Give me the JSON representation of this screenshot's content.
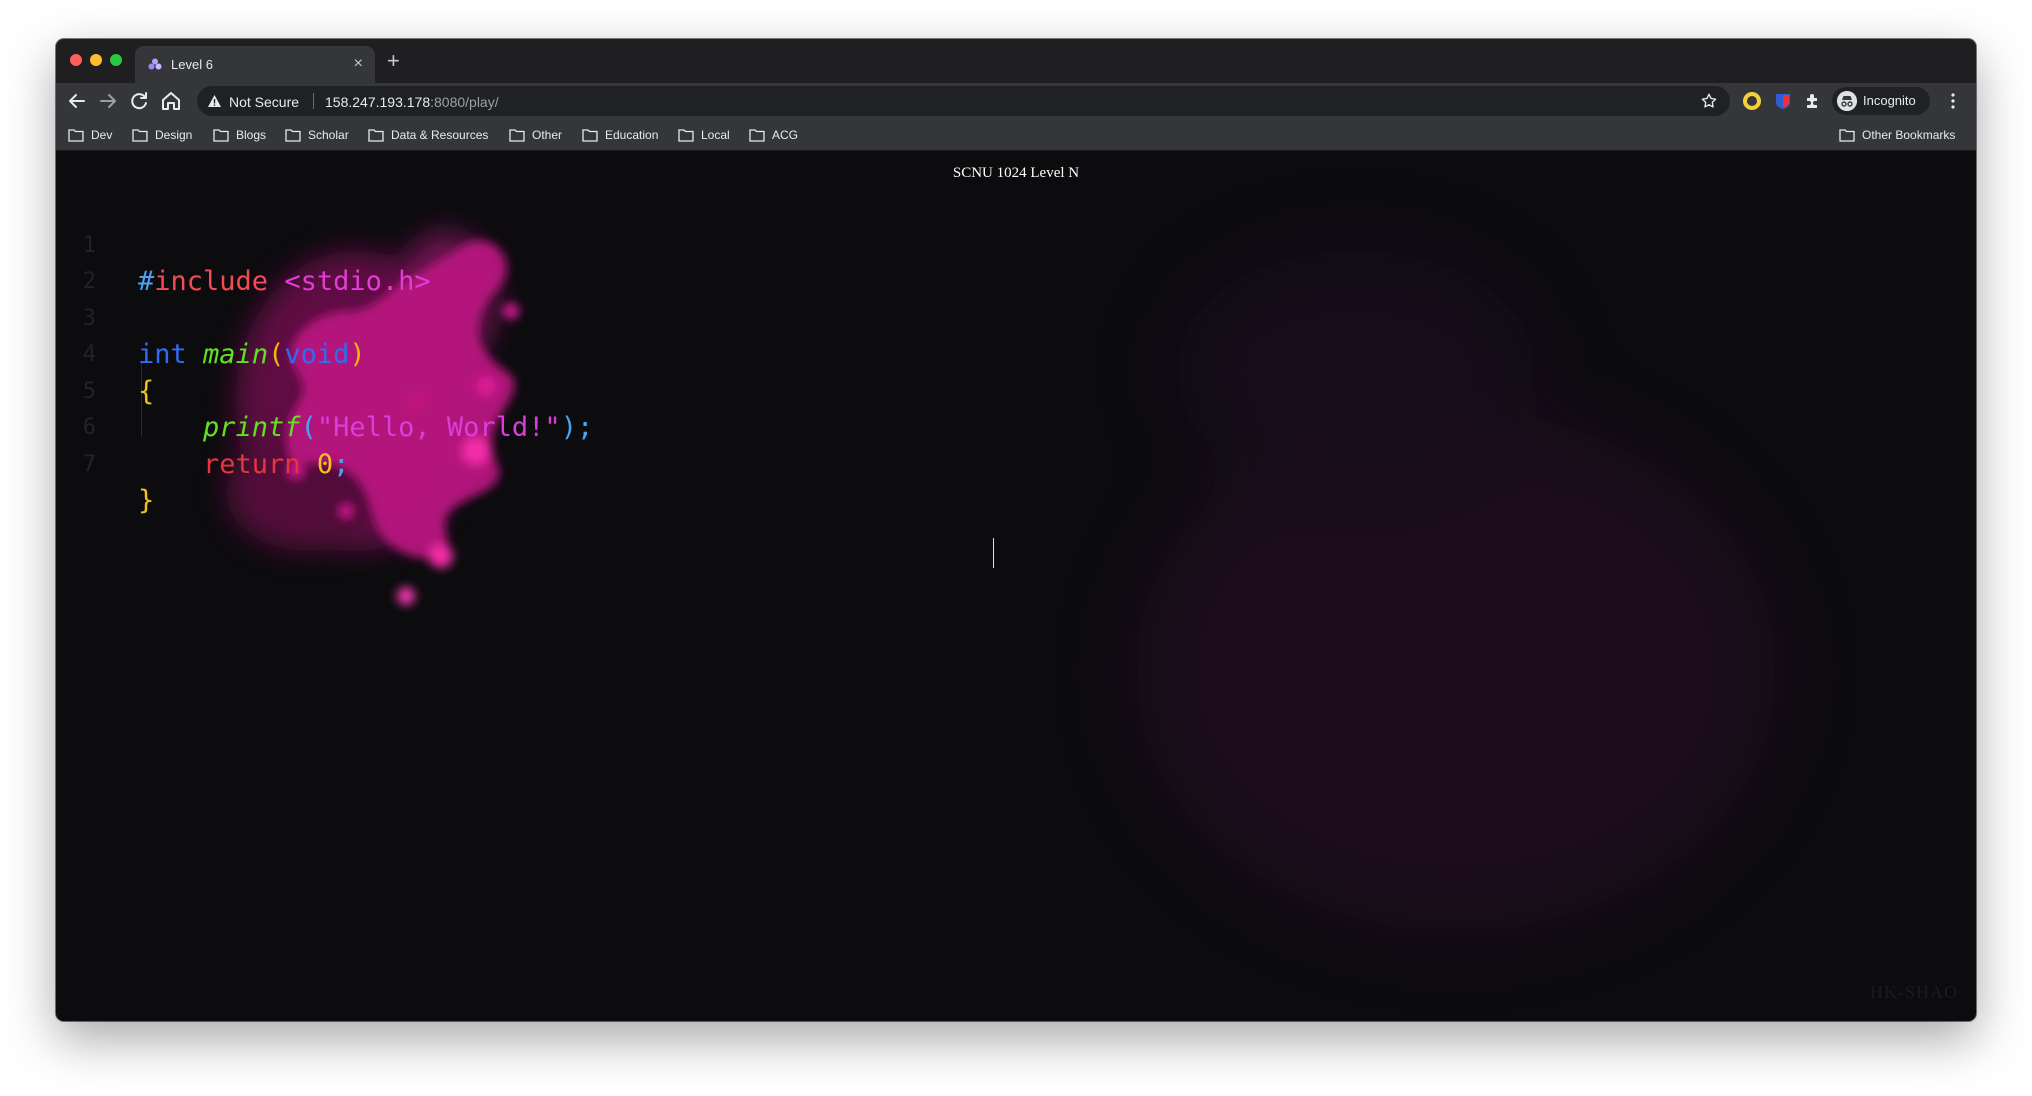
{
  "browser": {
    "tab": {
      "title": "Level 6",
      "close_glyph": "×"
    },
    "new_tab_glyph": "+",
    "omnibox": {
      "security_label": "Not Secure",
      "url_host": "158.247.193.178",
      "url_rest": ":8080/play/"
    },
    "profile_label": "Incognito",
    "bookmarks": [
      "Dev",
      "Design",
      "Blogs",
      "Scholar",
      "Data & Resources",
      "Other",
      "Education",
      "Local",
      "ACG"
    ],
    "other_bookmarks": "Other Bookmarks"
  },
  "page": {
    "title": "SCNU 1024 Level N",
    "watermark": "HK-SHAO",
    "line_numbers": [
      "1",
      "2",
      "3",
      "4",
      "5",
      "6",
      "7"
    ],
    "code": {
      "l1_hash": "#",
      "l1_include": "include",
      "l1_header": " <stdio.h>",
      "l3_int": "int",
      "l3_main": "main",
      "l3_open": "(",
      "l3_void": "void",
      "l3_close": ")",
      "l4_brace": "{",
      "l5_printf": "printf",
      "l5_open": "(",
      "l5_string": "\"Hello, World!\"",
      "l5_close": ")",
      "l5_semi": ";",
      "l6_return": "return",
      "l6_zero": "0",
      "l6_semi": ";",
      "l7_brace": "}"
    }
  },
  "colors": {
    "background": "#0c0c0e",
    "smoke": "#ff1aa5",
    "keyword_red": "#f54a57",
    "type_blue": "#2f6cf2",
    "function_green": "#61e21f",
    "string_magenta": "#d83fd8",
    "number_yellow": "#f2c21b"
  }
}
